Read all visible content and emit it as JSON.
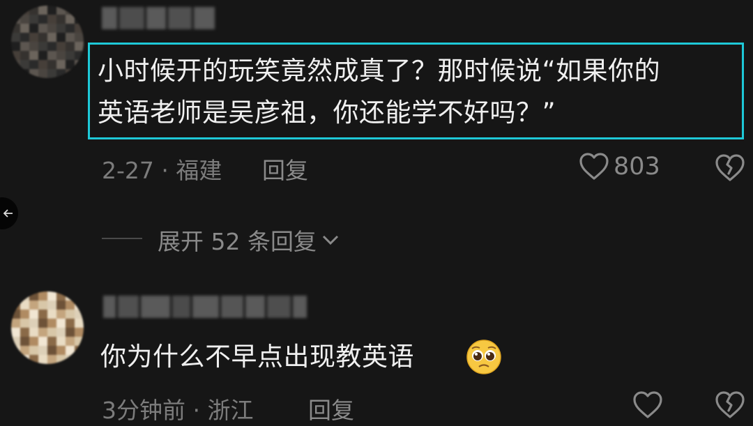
{
  "comments": [
    {
      "text_line1": "小时候开的玩笑竟然成真了？那时候说“如果你的",
      "text_line2": "英语老师是吴彦祖，你还能学不好吗？”",
      "date": "2-27",
      "location": "福建",
      "reply_label": "回复",
      "like_count": "803"
    },
    {
      "text": "你为什么不早点出现教英语",
      "emoji": "pleading-face",
      "time": "3分钟前",
      "location": "浙江",
      "reply_label": "回复",
      "like_count": ""
    }
  ],
  "expand_replies": {
    "label": "展开 52 条回复"
  },
  "colors": {
    "background": "#161616",
    "highlight": "#1ec9d8",
    "meta": "#7c7c7c"
  },
  "icons": {
    "like": "heart-outline-icon",
    "dislike": "broken-heart-icon",
    "expand": "chevron-down-icon",
    "back": "back-arrow-icon"
  }
}
